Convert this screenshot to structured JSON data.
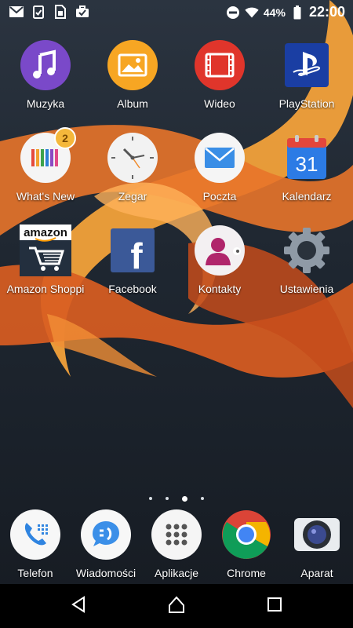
{
  "status_bar": {
    "icons_left": [
      "gmail-icon",
      "clipboard-check-icon",
      "sim-notification-icon",
      "briefcase-check-icon"
    ],
    "battery_percent": "44%",
    "time": "22:00",
    "icons_right": [
      "do-not-disturb-icon",
      "wifi-icon",
      "battery-icon"
    ]
  },
  "apps": [
    {
      "label": "Muzyka",
      "icon": "music-icon"
    },
    {
      "label": "Album",
      "icon": "album-icon"
    },
    {
      "label": "Wideo",
      "icon": "video-icon"
    },
    {
      "label": "PlayStation",
      "icon": "playstation-icon"
    },
    {
      "label": "What's New",
      "icon": "whats-new-icon",
      "badge": "2"
    },
    {
      "label": "Zegar",
      "icon": "clock-icon"
    },
    {
      "label": "Poczta",
      "icon": "mail-icon"
    },
    {
      "label": "Kalendarz",
      "icon": "calendar-icon",
      "icon_text": "31"
    },
    {
      "label": "Amazon Shoppi",
      "icon": "amazon-icon",
      "icon_text": "amazon"
    },
    {
      "label": "Facebook",
      "icon": "facebook-icon",
      "icon_text": "f"
    },
    {
      "label": "Kontakty",
      "icon": "contacts-icon"
    },
    {
      "label": "Ustawienia",
      "icon": "settings-icon"
    }
  ],
  "page_indicator": {
    "pages": 4,
    "active_index": 2
  },
  "dock": [
    {
      "label": "Telefon",
      "icon": "phone-icon"
    },
    {
      "label": "Wiadomości",
      "icon": "messages-icon"
    },
    {
      "label": "Aplikacje",
      "icon": "app-drawer-icon"
    },
    {
      "label": "Chrome",
      "icon": "chrome-icon"
    },
    {
      "label": "Aparat",
      "icon": "camera-icon"
    }
  ],
  "nav": [
    "back-icon",
    "home-icon",
    "recents-icon"
  ],
  "colors": {
    "wallpaper_orange": "#f08a2a",
    "wallpaper_dark": "#1f2731",
    "badge": "#f5b83b"
  }
}
